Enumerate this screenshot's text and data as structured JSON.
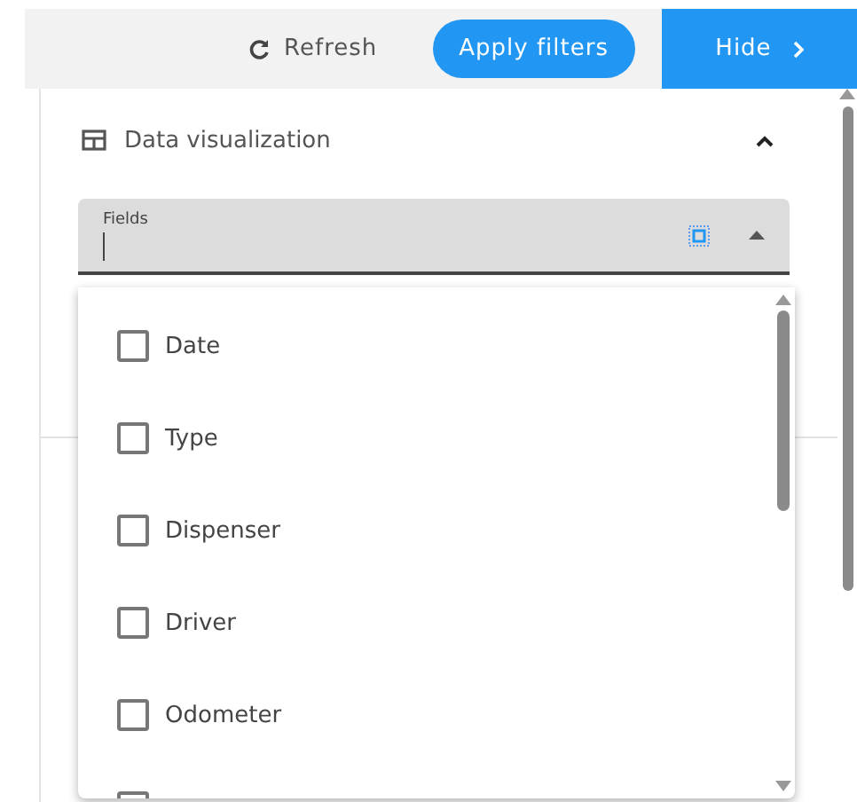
{
  "toolbar": {
    "refresh": "Refresh",
    "apply": "Apply filters",
    "hide": "Hide"
  },
  "section": {
    "title": "Data visualization",
    "expanded": true
  },
  "fields": {
    "label": "Fields",
    "open": true,
    "options": [
      {
        "label": "Date",
        "checked": false
      },
      {
        "label": "Type",
        "checked": false
      },
      {
        "label": "Dispenser",
        "checked": false
      },
      {
        "label": "Driver",
        "checked": false
      },
      {
        "label": "Odometer",
        "checked": false
      }
    ]
  }
}
